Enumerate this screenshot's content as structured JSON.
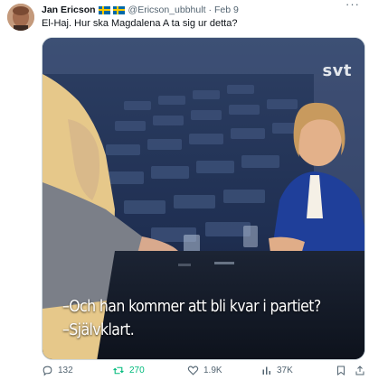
{
  "author": {
    "name": "Jan Ericson",
    "handle": "@Ericson_ubbhult",
    "date": "Feb 9",
    "flags": [
      "sweden-flag",
      "sweden-flag"
    ]
  },
  "tweet": {
    "text": "El-Haj. Hur ska Magdalena A ta sig ur detta?"
  },
  "media": {
    "watermark": "svt",
    "subtitle_line1": "–Och han kommer att bli kvar i partiet?",
    "subtitle_line2": "–Självklart."
  },
  "actions": {
    "replies": "132",
    "retweets": "270",
    "likes": "1.9K",
    "views": "37K"
  },
  "colors": {
    "text_primary": "#0f1419",
    "text_secondary": "#536471",
    "retweet_green": "#00ba7c",
    "border": "#cfd9de"
  }
}
